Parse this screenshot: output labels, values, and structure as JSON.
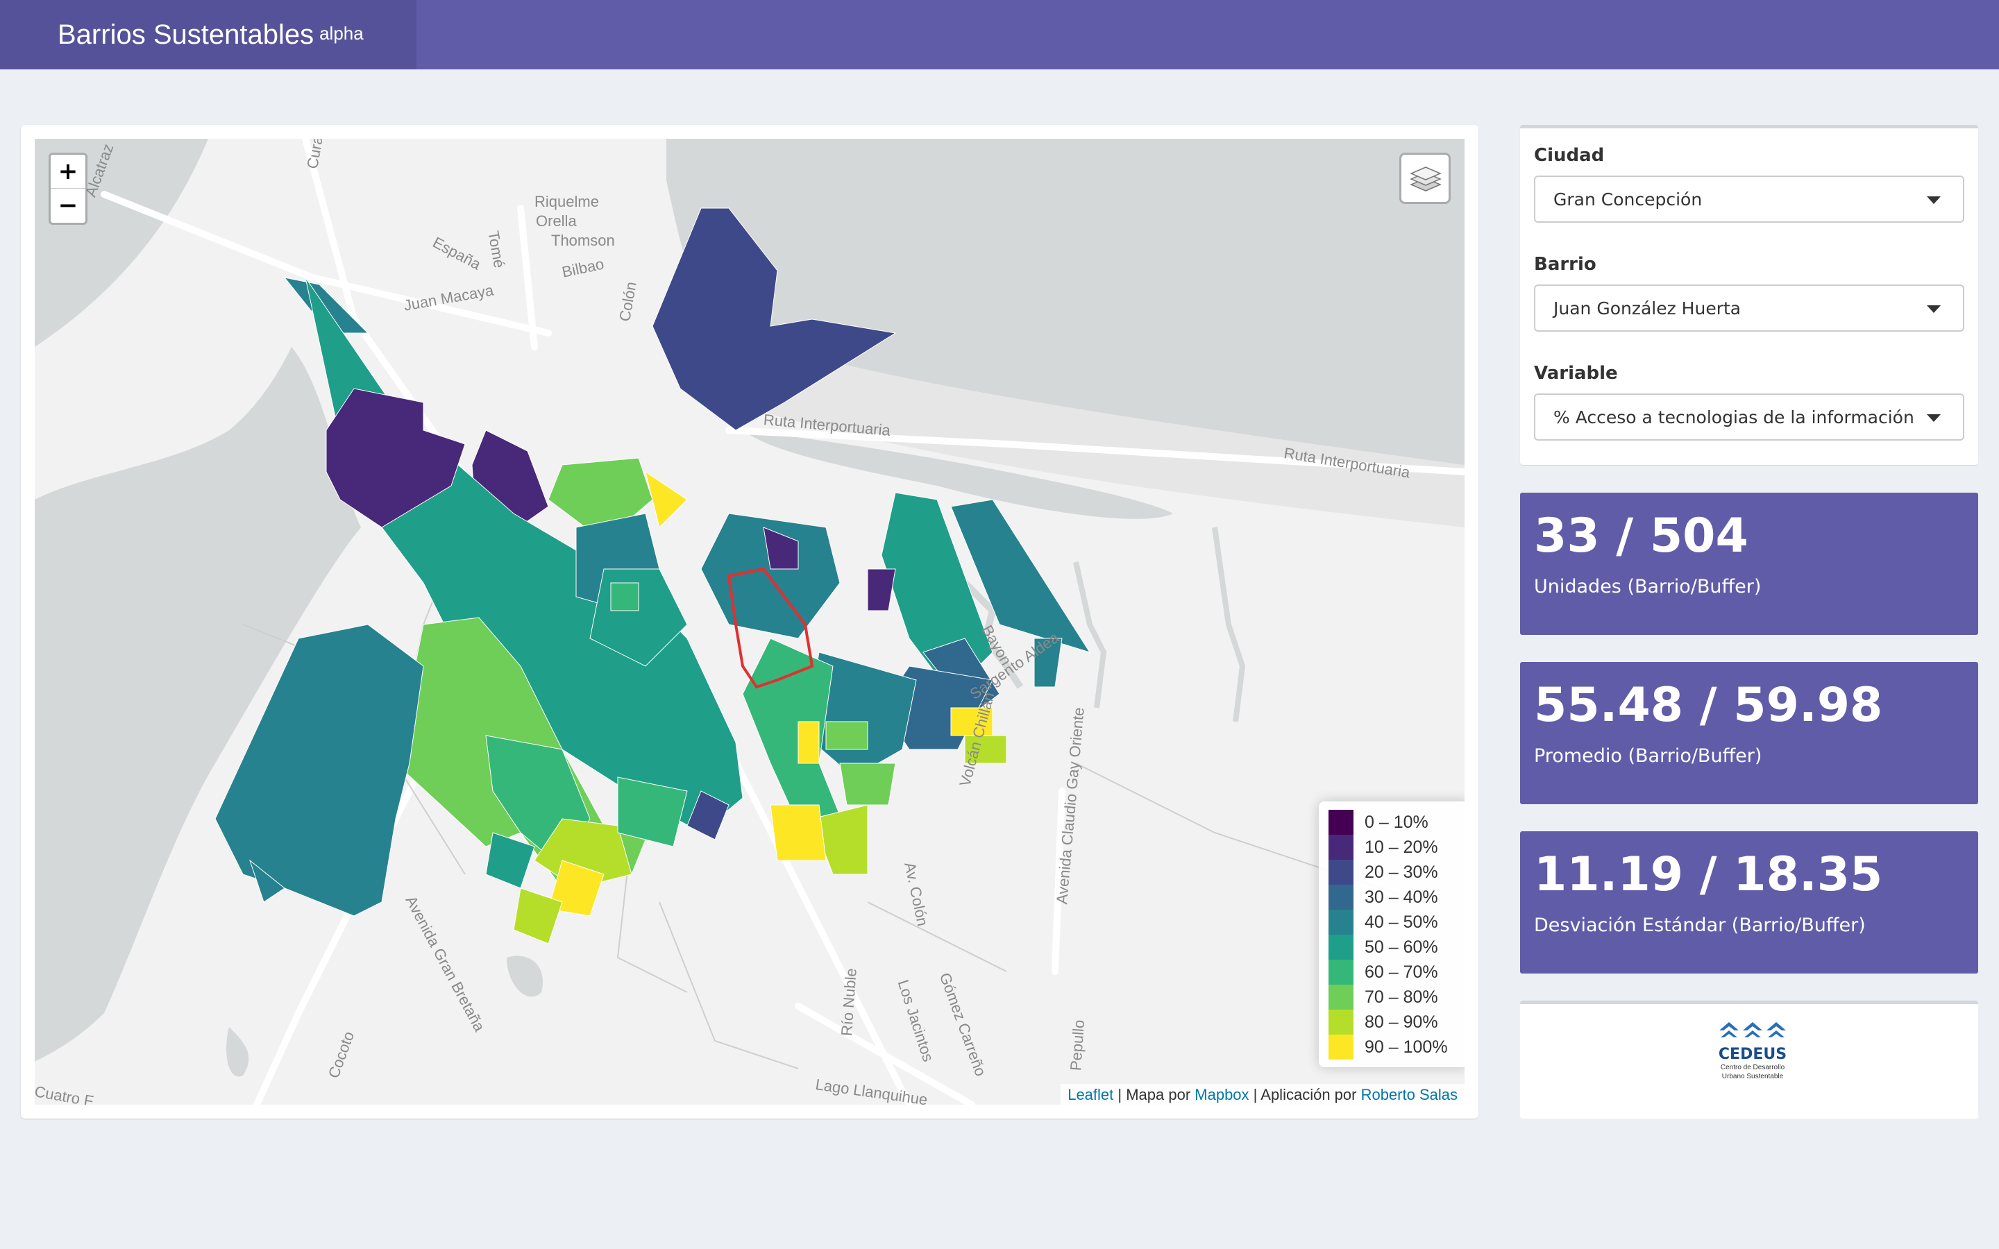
{
  "app": {
    "title": "Barrios Sustentables",
    "badge": "alpha"
  },
  "controls": {
    "ciudad": {
      "label": "Ciudad",
      "value": "Gran Concepción"
    },
    "barrio": {
      "label": "Barrio",
      "value": "Juan González Huerta"
    },
    "variable": {
      "label": "Variable",
      "value": "% Acceso a tecnologias de la información"
    }
  },
  "stats": [
    {
      "value": "33 / 504",
      "label": "Unidades (Barrio/Buffer)"
    },
    {
      "value": "55.48 / 59.98",
      "label": "Promedio (Barrio/Buffer)"
    },
    {
      "value": "11.19 / 18.35",
      "label": "Desviación Estándar (Barrio/Buffer)"
    }
  ],
  "map": {
    "zoom_in": "+",
    "zoom_out": "−",
    "street_labels": [
      "Alcatraz",
      "Curan",
      "Tomé",
      "Riquelme",
      "Orella",
      "Thomson",
      "España",
      "Bilbao",
      "Juan Macaya",
      "Colón",
      "Ruta Interportuaria",
      "Ruta Interportuaria",
      "Bayon",
      "Sargento Aldea",
      "Volcán Chillán",
      "Avenida Claudio Gay Oriente",
      "Av. Colón",
      "Gómez Carreño",
      "Los Jacintos",
      "Río Nuble",
      "Avenida Gran Bretaña",
      "Lago Llanquihue",
      "Pepullo",
      "Cuatro F",
      "Cocoto"
    ],
    "legend": [
      {
        "label": "0 – 10%",
        "color": "#440154"
      },
      {
        "label": "10 – 20%",
        "color": "#482878"
      },
      {
        "label": "20 – 30%",
        "color": "#3e4989"
      },
      {
        "label": "30 – 40%",
        "color": "#31688e"
      },
      {
        "label": "40 – 50%",
        "color": "#26828e"
      },
      {
        "label": "50 – 60%",
        "color": "#1f9e89"
      },
      {
        "label": "60 – 70%",
        "color": "#35b779"
      },
      {
        "label": "70 – 80%",
        "color": "#6ece58"
      },
      {
        "label": "80 – 90%",
        "color": "#b5de2b"
      },
      {
        "label": "90 – 100%",
        "color": "#fde725"
      }
    ],
    "attribution": {
      "leaflet": "Leaflet",
      "sep1": " | Mapa por ",
      "mapbox": "Mapbox",
      "sep2": " | Aplicación por ",
      "author": "Roberto Salas"
    }
  },
  "logo": {
    "title": "CEDEUS",
    "subtitle_1": "Centro de Desarrollo",
    "subtitle_2": "Urbano Sustentable"
  }
}
